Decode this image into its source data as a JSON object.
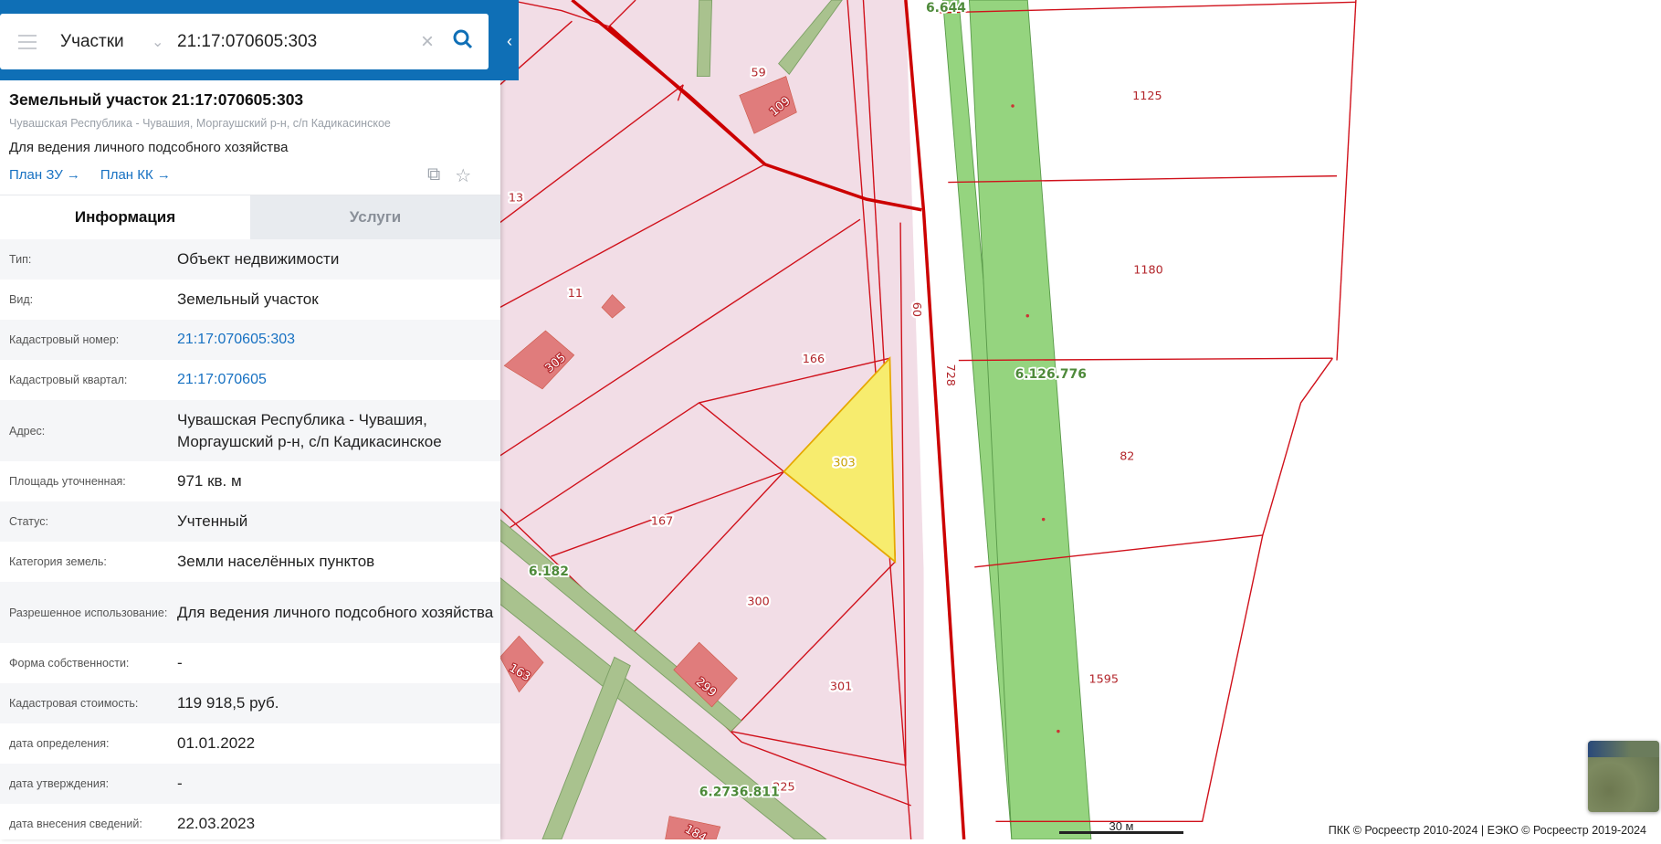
{
  "search": {
    "category": "Участки",
    "query": "21:17:070605:303"
  },
  "object": {
    "title": "Земельный участок 21:17:070605:303",
    "address": "Чувашская Республика - Чувашия, Моргаушский р-н, с/п Кадикасинское",
    "use": "Для ведения личного подсобного хозяйства",
    "links": [
      "План ЗУ →",
      "План КК →"
    ]
  },
  "tabs": [
    "Информация",
    "Услуги"
  ],
  "info": [
    {
      "k": "Тип:",
      "v": "Объект недвижимости"
    },
    {
      "k": "Вид:",
      "v": "Земельный участок"
    },
    {
      "k": "Кадастровый номер:",
      "v": "21:17:070605:303"
    },
    {
      "k": "Кадастровый квартал:",
      "v": "21:17:070605"
    },
    {
      "k": "Адрес:",
      "v": "Чувашская Республика - Чувашия, Моргаушский р-н, с/п Кадикасинское"
    },
    {
      "k": "Площадь уточненная:",
      "v": "971 кв. м"
    },
    {
      "k": "Статус:",
      "v": "Учтенный"
    },
    {
      "k": "Категория земель:",
      "v": "Земли населённых пунктов"
    },
    {
      "k": "Разрешенное использование:",
      "v": "Для ведения личного подсобного хозяйства"
    },
    {
      "k": "Форма собственности:",
      "v": "-"
    },
    {
      "k": "Кадастровая стоимость:",
      "v": "119 918,5 руб."
    },
    {
      "k": "дата определения:",
      "v": "01.01.2022"
    },
    {
      "k": "дата утверждения:",
      "v": "-"
    },
    {
      "k": "дата внесения сведений:",
      "v": "22.03.2023"
    }
  ],
  "map": {
    "parcels": [
      "59",
      "109",
      "13",
      "11",
      "305",
      "166",
      "303",
      "167",
      "300",
      "301",
      "299",
      "163",
      "225",
      "184",
      "60",
      "728",
      "1125",
      "1180",
      "82",
      "1595"
    ],
    "zones": [
      "6.644",
      "6.126.776",
      "6.182",
      "6.2736.811"
    ],
    "scale": "30 м",
    "attribution": "ПКК © Росреестр 2010-2024 | ЕЭКО © Росреестр 2019-2024"
  },
  "colors": {
    "brand": "#0f6fb6",
    "selected": "#f7ec6e",
    "boundary": "#d0021b"
  }
}
